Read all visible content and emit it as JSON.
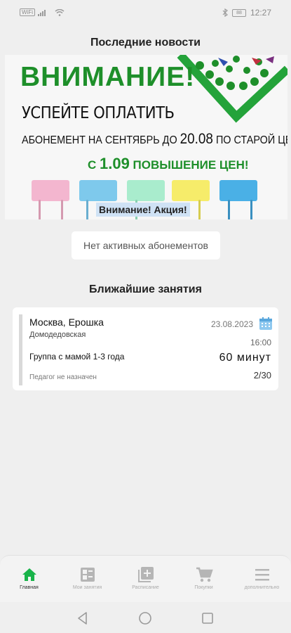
{
  "status_bar": {
    "left_chip": "WiFi",
    "battery": "88",
    "time": "12:27"
  },
  "news": {
    "title": "Последние новости",
    "banner": {
      "headline": "ВНИМАНИЕ!",
      "line1": "УСПЕЙТЕ ОПЛАТИТЬ",
      "line2_a": "АБОНЕМЕНТ НА СЕНТЯБРЬ ДО ",
      "line2_b": "20.08",
      "line2_c": " ПО СТАРОЙ ЦЕНЕ",
      "line3_a": "С ",
      "line3_b": "1.09",
      "line3_c": " ПОВЫШЕНИЕ ЦЕН!",
      "tag": "Внимание! Акция!",
      "accent_color": "#1e8f2a"
    }
  },
  "subscriptions": {
    "empty_text": "Нет активных абонементов"
  },
  "upcoming": {
    "title": "Ближайшие занятия",
    "lessons": [
      {
        "place": "Москва, Ерошка",
        "metro": "Домодедовская",
        "group": "Группа с мамой 1-3 года",
        "teacher": "Педагог не назначен",
        "date": "23.08.2023",
        "time": "16:00",
        "duration": "60 минут",
        "count": "2/30"
      }
    ]
  },
  "bottom_nav": {
    "active_color": "#19b34a",
    "items": [
      {
        "label": "Главная",
        "icon": "home-icon"
      },
      {
        "label": "Мои занятия",
        "icon": "grid-icon"
      },
      {
        "label": "Расписание",
        "icon": "add-box-icon"
      },
      {
        "label": "Покупки",
        "icon": "cart-icon"
      },
      {
        "label": "дополнительно",
        "icon": "menu-icon"
      }
    ]
  }
}
